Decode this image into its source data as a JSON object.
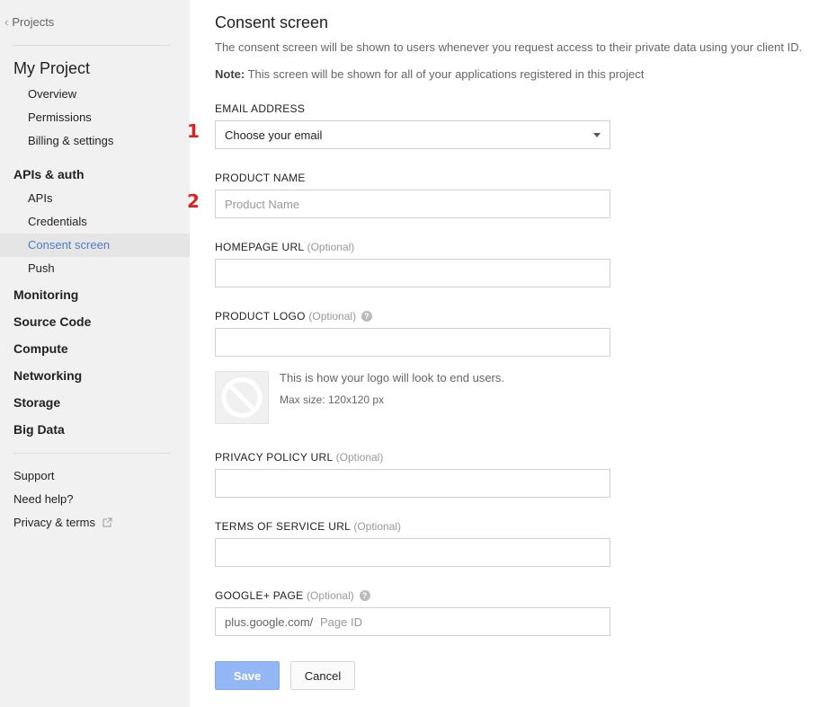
{
  "sidebar": {
    "back_label": "Projects",
    "project_title": "My Project",
    "project_items": [
      "Overview",
      "Permissions",
      "Billing & settings"
    ],
    "apis_section": "APIs & auth",
    "apis_items": [
      "APIs",
      "Credentials",
      "Consent screen",
      "Push"
    ],
    "active_item": "Consent screen",
    "sections": [
      "Monitoring",
      "Source Code",
      "Compute",
      "Networking",
      "Storage",
      "Big Data"
    ],
    "footer": [
      "Support",
      "Need help?",
      "Privacy & terms"
    ]
  },
  "main": {
    "title": "Consent screen",
    "intro": "The consent screen will be shown to users whenever you request access to their private data using your client ID.",
    "note_label": "Note:",
    "note_text": " This screen will be shown for all of your applications registered in this project",
    "optional": "(Optional)",
    "annotations": [
      "1",
      "2"
    ],
    "email": {
      "label": "EMAIL ADDRESS",
      "value": "Choose your email"
    },
    "product_name": {
      "label": "PRODUCT NAME",
      "placeholder": "Product Name"
    },
    "homepage": {
      "label": "HOMEPAGE URL",
      "value": ""
    },
    "logo": {
      "label": "PRODUCT LOGO",
      "value": "",
      "preview_text": "This is how your logo will look to end users.",
      "max_size": "Max size: 120x120 px"
    },
    "privacy": {
      "label": "PRIVACY POLICY URL",
      "value": ""
    },
    "tos": {
      "label": "TERMS OF SERVICE URL",
      "value": ""
    },
    "gplus": {
      "label": "GOOGLE+ PAGE",
      "prefix": "plus.google.com/",
      "placeholder": "Page ID"
    },
    "buttons": {
      "save": "Save",
      "cancel": "Cancel"
    }
  },
  "colors": {
    "accent": "#4d7ec2",
    "save_button": "#93b7f4",
    "annotation": "#e02020",
    "sidebar_bg": "#f1f1f1"
  }
}
